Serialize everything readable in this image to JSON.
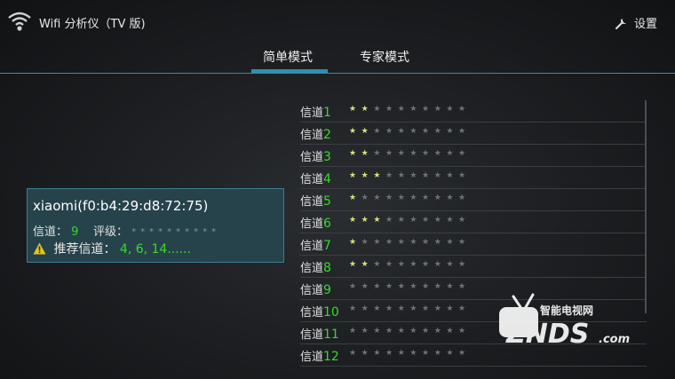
{
  "header": {
    "title": "Wifi 分析仪（TV 版)",
    "settings_label": "设置"
  },
  "tabs": [
    {
      "label": "简单模式",
      "selected": true
    },
    {
      "label": "专家模式",
      "selected": false
    }
  ],
  "network": {
    "ssid_line": "xiaomi(f0:b4:29:d8:72:75)",
    "channel_label": "信道：",
    "channel_value": "9",
    "rating_label": "评级：",
    "rating_dots": "**********",
    "recommend_label": "推荐信道：",
    "recommend_value": "4, 6, 14......"
  },
  "channels_prefix": "信道",
  "channels": [
    {
      "num": "1",
      "rating": 2
    },
    {
      "num": "2",
      "rating": 2
    },
    {
      "num": "3",
      "rating": 2
    },
    {
      "num": "4",
      "rating": 3
    },
    {
      "num": "5",
      "rating": 1
    },
    {
      "num": "6",
      "rating": 3
    },
    {
      "num": "7",
      "rating": 1
    },
    {
      "num": "8",
      "rating": 2
    },
    {
      "num": "9",
      "rating": 0
    },
    {
      "num": "10",
      "rating": 0
    },
    {
      "num": "11",
      "rating": 0
    },
    {
      "num": "12",
      "rating": 0
    }
  ],
  "channel_max_rating": 10,
  "watermark": {
    "line1": "智能电视网",
    "line2": "ZNDS",
    "line3": ".com"
  },
  "colors": {
    "accent": "#2f8fb0",
    "good": "#39d92c",
    "star": "#d8e27a"
  }
}
